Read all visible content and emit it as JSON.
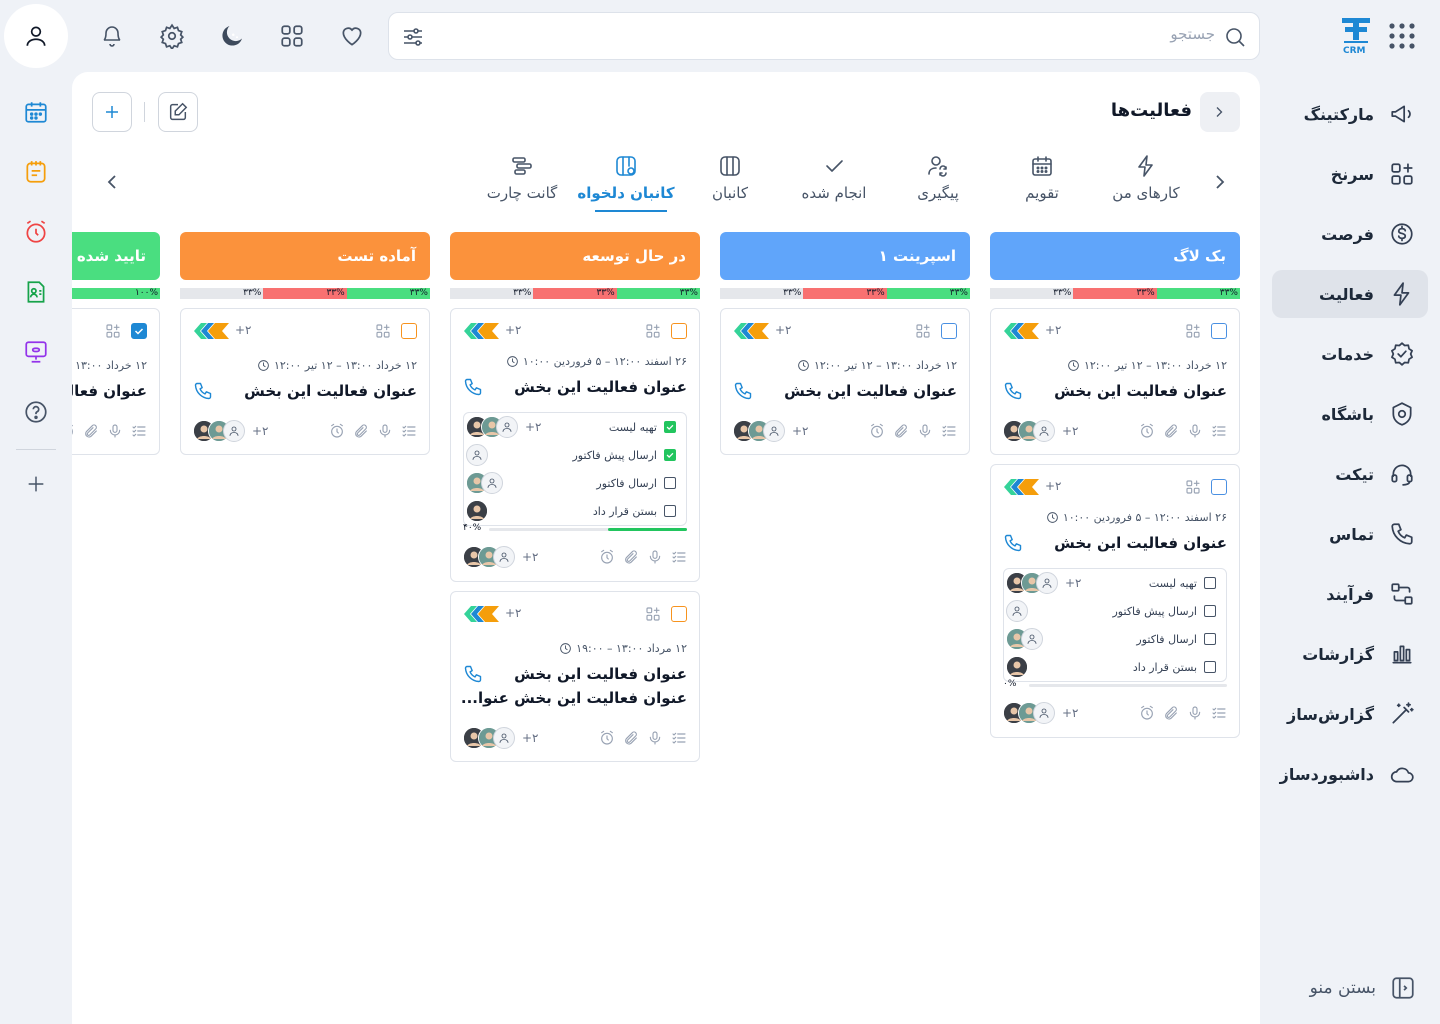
{
  "search": {
    "placeholder": "جستجو"
  },
  "logo": {
    "sub": "CRM",
    "brand_color": "#1e88d4"
  },
  "top_icons": [
    "bell-icon",
    "settings-icon",
    "moon-icon",
    "apps-icon",
    "heart-icon"
  ],
  "sidebar": {
    "items": [
      {
        "label": "مارکتینگ",
        "icon": "megaphone-icon"
      },
      {
        "label": "سرنخ",
        "icon": "shapes-icon"
      },
      {
        "label": "فرصت",
        "icon": "dollar-icon"
      },
      {
        "label": "فعالیت",
        "icon": "bolt-icon",
        "active": true
      },
      {
        "label": "خدمات",
        "icon": "badge-icon"
      },
      {
        "label": "باشگاه",
        "icon": "club-icon"
      },
      {
        "label": "تیکت",
        "icon": "headset-icon"
      },
      {
        "label": "تماس",
        "icon": "phone-icon"
      },
      {
        "label": "فرآیند",
        "icon": "flow-icon"
      },
      {
        "label": "گزارشات",
        "icon": "bars-icon"
      },
      {
        "label": "گزارش‌ساز",
        "icon": "wand-icon"
      },
      {
        "label": "داشبوردساز",
        "icon": "cloud-icon"
      }
    ],
    "collapse": "بستن منو"
  },
  "page": {
    "title": "فعالیت‌ها"
  },
  "tabs": [
    {
      "label": "کارهای من",
      "icon": "bolt-icon"
    },
    {
      "label": "تقویم",
      "icon": "calendar-icon"
    },
    {
      "label": "پیگیری",
      "icon": "user-refresh-icon"
    },
    {
      "label": "انجام شده",
      "icon": "check-icon"
    },
    {
      "label": "کانبان",
      "icon": "kanban-icon"
    },
    {
      "label": "کانبان دلخواه",
      "icon": "kanban-custom-icon",
      "active": true
    },
    {
      "label": "گانت چارت",
      "icon": "gantt-icon"
    }
  ],
  "columns": [
    {
      "title": "بک لاگ",
      "color": "#60a5fa",
      "progress": [
        "۳۳%",
        "۳۳%",
        "۳۳%"
      ]
    },
    {
      "title": "اسپرینت ۱",
      "color": "#60a5fa",
      "progress": [
        "۳۳%",
        "۳۳%",
        "۳۳%"
      ]
    },
    {
      "title": "در حال توسعه",
      "color": "#fb923c",
      "progress": [
        "۳۳%",
        "۳۳%",
        "۳۳%"
      ]
    },
    {
      "title": "آماده تست",
      "color": "#fb923c",
      "progress": [
        "۳۳%",
        "۳۳%",
        "۳۳%"
      ]
    },
    {
      "title": "تایید شده",
      "color": "#4ade80",
      "progress": [
        "۱۰۰%"
      ]
    }
  ],
  "card_text": {
    "plus": "+۲",
    "date_short": "۱۲ خرداد ۱۳:۰۰ – ۱۲ تیر ۱۲:۰۰",
    "date_long": "۲۶ اسفند ۱۲:۰۰ – ۵ فروردین ۱۰:۰۰",
    "date_mordad": "۱۲ مرداد ۱۳:۰۰ – ۱۹:۰۰",
    "title": "عنوان فعالیت این بخش",
    "title_line2": "عنوان فعالیت این بخش عنوا...",
    "edge_date": "۱۲ خرداد",
    "edge_title": "عنوان فع"
  },
  "checklist": [
    "تهیه لیست",
    "ارسال پیش فاکتور",
    "ارسال فاکتور",
    "بستن قرار داد"
  ],
  "progress": {
    "zero": "۰%",
    "forty": "۴۰%",
    "forty_value": 0.4
  }
}
